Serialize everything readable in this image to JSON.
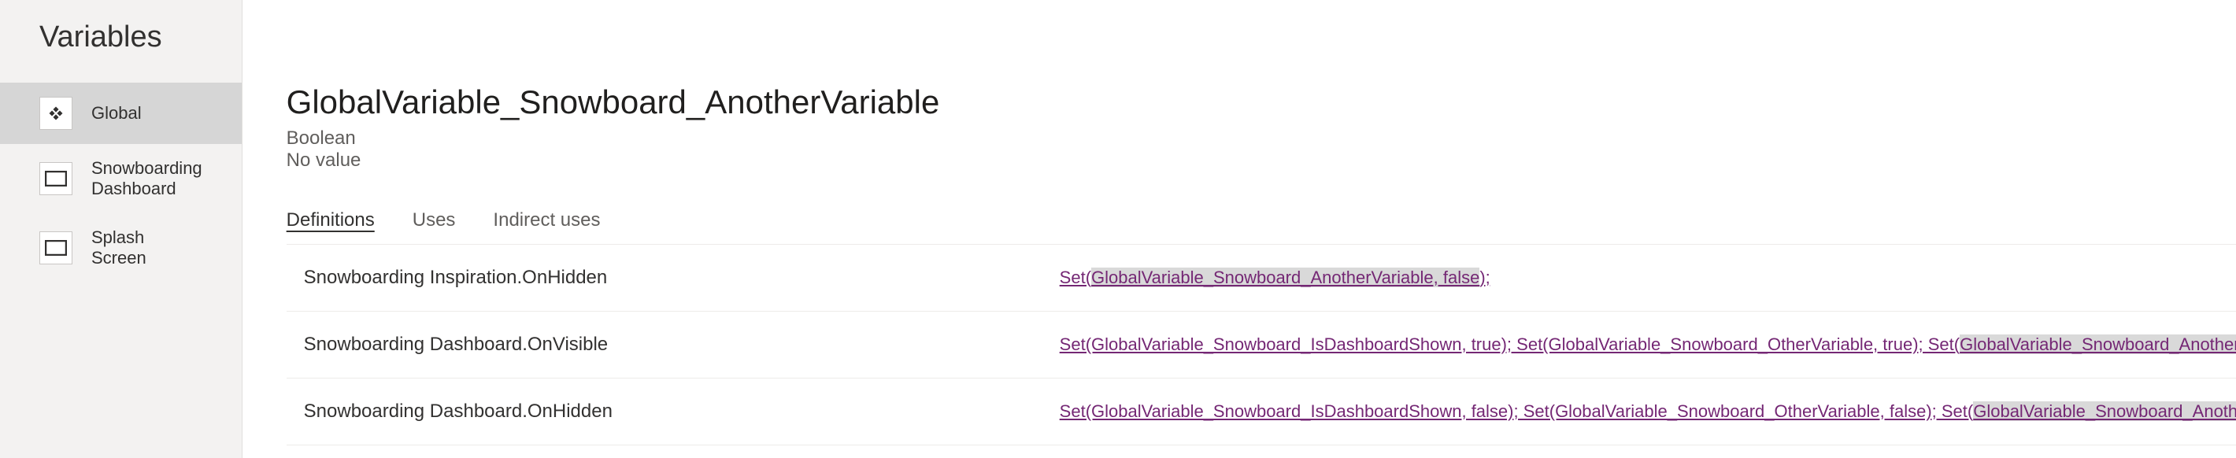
{
  "sidebar": {
    "title": "Variables",
    "items": [
      {
        "label": "Global",
        "icon": "global-icon",
        "selected": true
      },
      {
        "label": "Snowboarding Dashboard",
        "icon": "screen-icon",
        "selected": false
      },
      {
        "label": "Splash Screen",
        "icon": "screen-icon",
        "selected": false
      }
    ]
  },
  "main": {
    "variable_name": "GlobalVariable_Snowboard_AnotherVariable",
    "variable_type": "Boolean",
    "variable_value": "No value",
    "tabs": [
      {
        "label": "Definitions",
        "active": true
      },
      {
        "label": "Uses",
        "active": false
      },
      {
        "label": "Indirect uses",
        "active": false
      }
    ],
    "definitions": [
      {
        "location": "Snowboarding Inspiration.OnHidden",
        "formula_parts": [
          {
            "text": "Set(",
            "hl": false
          },
          {
            "text": "GlobalVariable_Snowboard_AnotherVariable, false",
            "hl": true
          },
          {
            "text": ");",
            "hl": false
          }
        ]
      },
      {
        "location": "Snowboarding Dashboard.OnVisible",
        "formula_parts": [
          {
            "text": "Set(GlobalVariable_Snowboard_IsDashboardShown, true);  Set(GlobalVariable_Snowboard_OtherVariable, true);  Set(",
            "hl": false
          },
          {
            "text": "GlobalVariable_Snowboard_AnotherVariable, true",
            "hl": true
          },
          {
            "text": ");",
            "hl": false
          }
        ]
      },
      {
        "location": "Snowboarding Dashboard.OnHidden",
        "formula_parts": [
          {
            "text": "Set(GlobalVariable_Snowboard_IsDashboardShown, false);  Set(GlobalVariable_Snowboard_OtherVariable, false);  Set(",
            "hl": false
          },
          {
            "text": "GlobalVariable_Snowboard_AnotherVariable, false",
            "hl": true
          },
          {
            "text": ");",
            "hl": false
          }
        ]
      }
    ]
  }
}
